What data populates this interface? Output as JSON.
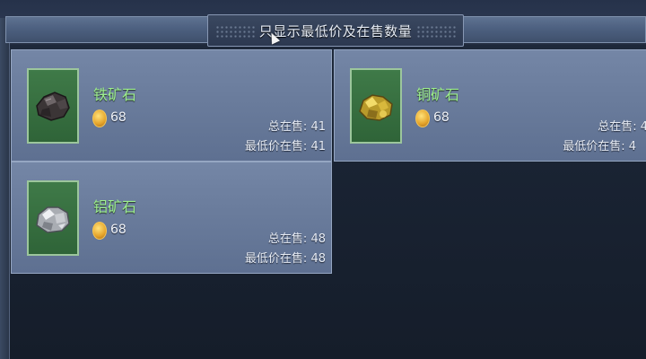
{
  "filter": {
    "label": "只显示最低价及在售数量"
  },
  "colors": {
    "name_text": "#9ef08e",
    "card_bg": "#6b7d9d",
    "thumb_bg": "#2f6438",
    "coin": "#e5a42a"
  },
  "items": [
    {
      "name": "铁矿石",
      "price": "68",
      "total_label": "总在售:",
      "total": "41",
      "lowest_label": "最低价在售:",
      "lowest": "41",
      "icon": "iron-ore-icon"
    },
    {
      "name": "铜矿石",
      "price": "68",
      "total_label": "总在售:",
      "total": "4",
      "lowest_label": "最低价在售:",
      "lowest": "4",
      "icon": "copper-ore-icon"
    },
    {
      "name": "铝矿石",
      "price": "68",
      "total_label": "总在售:",
      "total": "48",
      "lowest_label": "最低价在售:",
      "lowest": "48",
      "icon": "aluminum-ore-icon"
    }
  ]
}
